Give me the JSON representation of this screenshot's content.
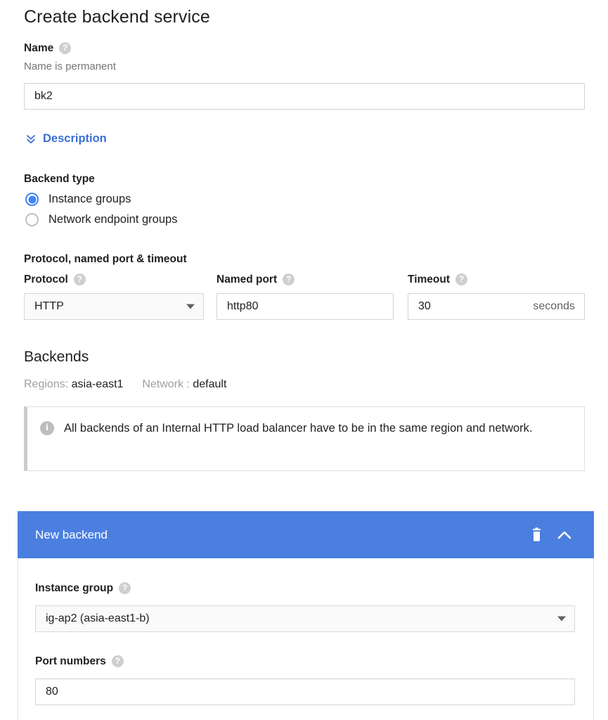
{
  "page": {
    "title": "Create backend service"
  },
  "name_section": {
    "label": "Name",
    "help_icon": "help-icon",
    "hint": "Name is permanent",
    "value": "bk2",
    "placeholder": ""
  },
  "description_toggle": {
    "label": "Description",
    "icon": "double-chevron-down-icon",
    "color": "#3b6fd4"
  },
  "backend_type": {
    "label": "Backend type",
    "options": [
      {
        "label": "Instance groups",
        "selected": true
      },
      {
        "label": "Network endpoint groups",
        "selected": false
      }
    ],
    "selected_color": "#4285f4"
  },
  "protocol_section": {
    "label": "Protocol, named port & timeout",
    "protocol": {
      "label": "Protocol",
      "value": "HTTP",
      "icon": "chevron-down-icon"
    },
    "named_port": {
      "label": "Named port",
      "value": "http80"
    },
    "timeout": {
      "label": "Timeout",
      "value": "30",
      "suffix": "seconds"
    }
  },
  "backends_section": {
    "title": "Backends",
    "regions_label": "Regions:",
    "regions_value": "asia-east1",
    "network_label": "Network :",
    "network_value": "default",
    "info": {
      "icon": "info-icon",
      "text": "All backends of an Internal HTTP load balancer have to be in the same region and network."
    }
  },
  "new_backend": {
    "title": "New backend",
    "header_color": "#4a7fe0",
    "delete_icon": "trash-icon",
    "collapse_icon": "chevron-up-icon",
    "instance_group": {
      "label": "Instance group",
      "value": "ig-ap2 (asia-east1-b)",
      "icon": "chevron-down-icon"
    },
    "port_numbers": {
      "label": "Port numbers",
      "value": "80"
    }
  }
}
